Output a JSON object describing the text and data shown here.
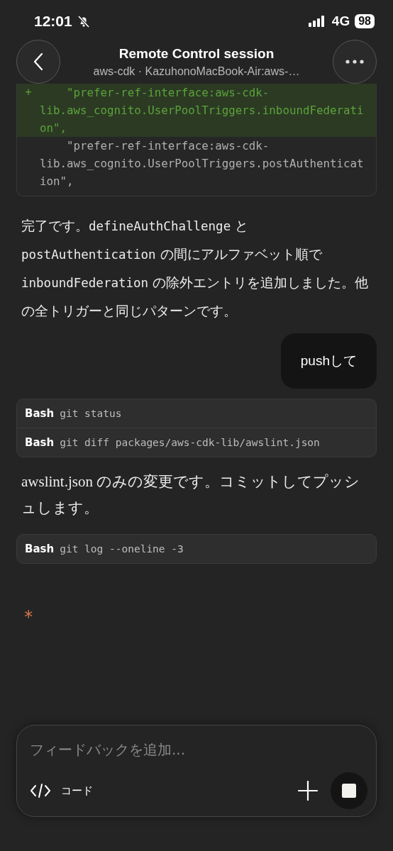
{
  "status_bar": {
    "time": "12:01",
    "silent": true,
    "network": "4G",
    "battery": "98"
  },
  "header": {
    "title": "Remote Control session",
    "subtitle": "aws-cdk · KazuhonoMacBook-Air:aws-…"
  },
  "diff": {
    "lines": [
      {
        "kind": "added",
        "marker": "+",
        "text": "    \"prefer-ref-interface:aws-cdk-lib.aws_cognito.UserPoolTriggers.inboundFederation\","
      },
      {
        "kind": "context",
        "text": "    \"prefer-ref-interface:aws-cdk-lib.aws_cognito.UserPoolTriggers.postAuthentication\","
      }
    ]
  },
  "messages": [
    {
      "kind": "assistant",
      "parts": [
        {
          "kind": "text",
          "text": "完了です。"
        },
        {
          "kind": "code",
          "text": "defineAuthChallenge"
        },
        {
          "kind": "text",
          "text": " と "
        },
        {
          "kind": "code",
          "text": "postAuthentication"
        },
        {
          "kind": "text",
          "text": " の間にアルファベット順で "
        },
        {
          "kind": "code",
          "text": "inboundFederation"
        },
        {
          "kind": "text",
          "text": " の除外エントリを追加しました。他の全トリガーと同じパターンです。"
        }
      ]
    },
    {
      "kind": "user",
      "text": "pushして"
    },
    {
      "kind": "tools",
      "calls": [
        {
          "tool": "Bash",
          "command": "git status"
        },
        {
          "tool": "Bash",
          "command": "git diff packages/aws-cdk-lib/awslint.json"
        }
      ]
    },
    {
      "kind": "note",
      "text": "awslint.json のみの変更です。コミットしてプッシュします。"
    },
    {
      "kind": "tools",
      "calls": [
        {
          "tool": "Bash",
          "command": "git log --oneline -3"
        }
      ]
    },
    {
      "kind": "working",
      "text": "*"
    }
  ],
  "composer": {
    "placeholder": "フィードバックを追加...",
    "mode_label": "コード",
    "running": true
  }
}
